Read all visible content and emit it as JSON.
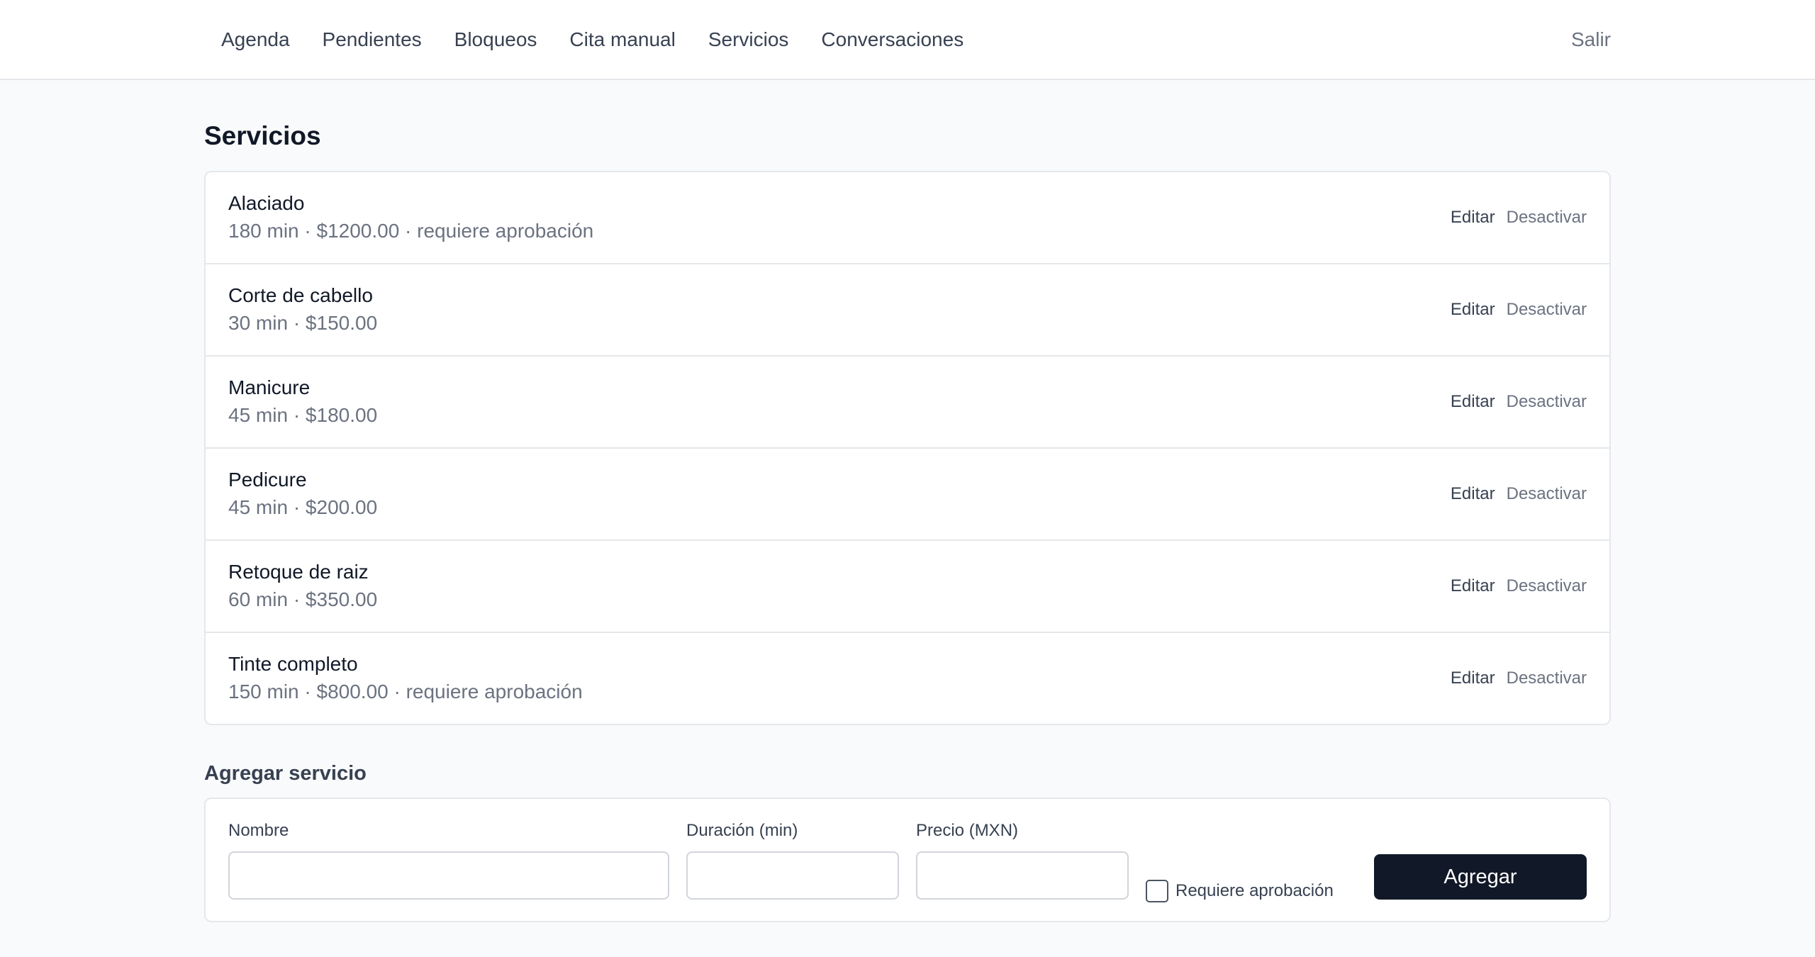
{
  "nav": {
    "links": [
      "Agenda",
      "Pendientes",
      "Bloqueos",
      "Cita manual",
      "Servicios",
      "Conversaciones"
    ],
    "logout": "Salir"
  },
  "page": {
    "title": "Servicios"
  },
  "services": [
    {
      "name": "Alaciado",
      "meta": "180 min · $1200.00 · requiere aprobación"
    },
    {
      "name": "Corte de cabello",
      "meta": "30 min · $150.00"
    },
    {
      "name": "Manicure",
      "meta": "45 min · $180.00"
    },
    {
      "name": "Pedicure",
      "meta": "45 min · $200.00"
    },
    {
      "name": "Retoque de raiz",
      "meta": "60 min · $350.00"
    },
    {
      "name": "Tinte completo",
      "meta": "150 min · $800.00 · requiere aprobación"
    }
  ],
  "actions": {
    "edit": "Editar",
    "deactivate": "Desactivar"
  },
  "add_form": {
    "title": "Agregar servicio",
    "name_label": "Nombre",
    "name_value": "",
    "duration_label": "Duración (min)",
    "duration_value": "",
    "price_label": "Precio (MXN)",
    "price_value": "",
    "requires_approval_label": "Requiere aprobación",
    "requires_approval_checked": false,
    "submit_label": "Agregar"
  }
}
